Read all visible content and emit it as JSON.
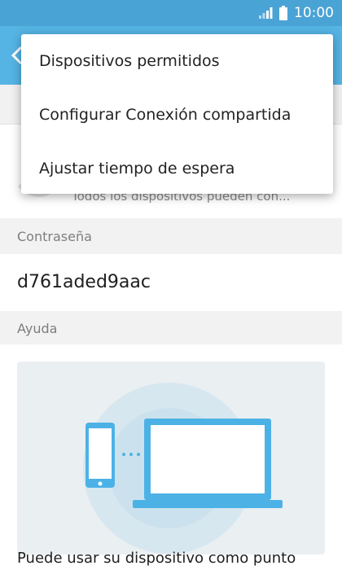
{
  "status_bar": {
    "time": "10:00",
    "signal_icon": "signal-icon",
    "battery_icon": "battery-icon"
  },
  "app_bar": {
    "back_icon": "back-arrow-icon"
  },
  "allowed_devices": {
    "summary": "Todos los dispositivos pueden con..."
  },
  "password": {
    "header": "Contraseña",
    "value": "d761aded9aac"
  },
  "help": {
    "header": "Ayuda",
    "illustration": "phone-laptop-hotspot-illustration",
    "text": "Puede usar su dispositivo como punto"
  },
  "menu": {
    "items": [
      {
        "label": "Dispositivos permitidos"
      },
      {
        "label": "Configurar Conexión compartida"
      },
      {
        "label": "Ajustar tiempo de espera"
      }
    ]
  },
  "colors": {
    "status_bar": "#4aa3d5",
    "app_bar": "#55b4e4",
    "illustration_accent": "#4cb2e6",
    "illustration_bg": "#eaeff2"
  }
}
